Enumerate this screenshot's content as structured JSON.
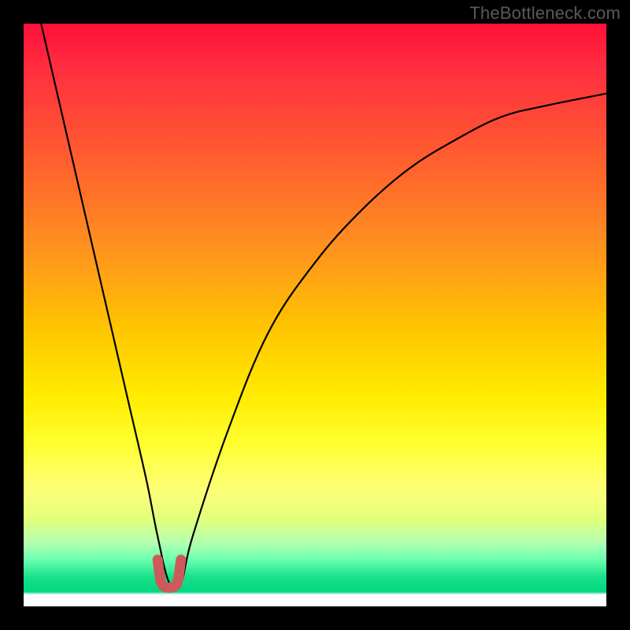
{
  "watermark": "TheBottleneck.com",
  "chart_data": {
    "type": "line",
    "title": "",
    "xlabel": "",
    "ylabel": "",
    "xlim": [
      0,
      100
    ],
    "ylim": [
      0,
      100
    ],
    "grid": false,
    "legend": false,
    "series": [
      {
        "name": "bottleneck-curve",
        "x": [
          3,
          6,
          9,
          12,
          15,
          18,
          21,
          23,
          25,
          27,
          29,
          35,
          42,
          50,
          58,
          66,
          74,
          82,
          90,
          100
        ],
        "y": [
          100,
          87,
          74,
          61,
          48,
          35,
          22,
          12,
          4,
          4,
          12,
          30,
          47,
          59,
          68,
          75,
          80,
          84,
          86,
          88
        ],
        "color": "#000000"
      },
      {
        "name": "optimal-marker",
        "x": [
          23,
          23.5,
          24,
          25,
          26,
          26.5,
          27
        ],
        "y": [
          8,
          4.5,
          3.5,
          3.2,
          3.5,
          4.5,
          8
        ],
        "color": "#cc5a5a"
      }
    ],
    "background_gradient": {
      "top": "#ff103a",
      "mid": "#ffec00",
      "bottom": "#00d880"
    }
  }
}
